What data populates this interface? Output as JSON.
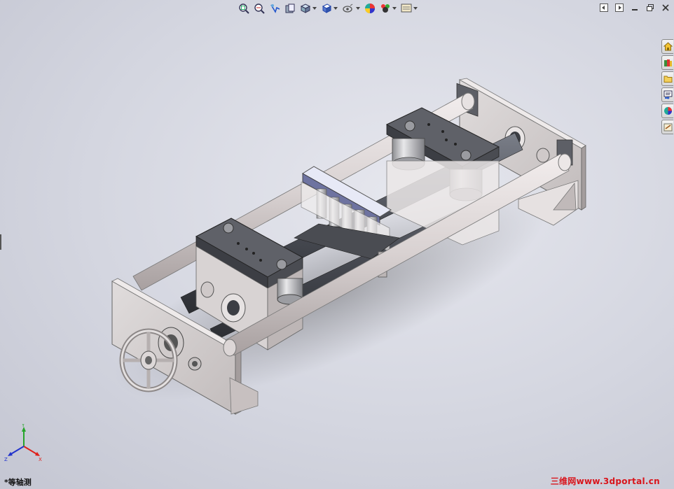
{
  "heads_up_toolbar": {
    "items": [
      {
        "name": "zoom-to-fit",
        "has_dropdown": false
      },
      {
        "name": "zoom-to-area",
        "has_dropdown": false
      },
      {
        "name": "previous-view",
        "has_dropdown": false
      },
      {
        "name": "section-view",
        "has_dropdown": false
      },
      {
        "name": "view-orientation",
        "has_dropdown": true
      },
      {
        "name": "display-style",
        "has_dropdown": true
      },
      {
        "name": "hide-show-items",
        "has_dropdown": true
      },
      {
        "name": "edit-appearance",
        "has_dropdown": false
      },
      {
        "name": "apply-scene",
        "has_dropdown": true
      },
      {
        "name": "view-settings",
        "has_dropdown": true
      }
    ]
  },
  "window_controls": {
    "buttons": [
      "tile-left",
      "tile-right",
      "minimize",
      "restore",
      "close"
    ]
  },
  "task_pane": {
    "tabs": [
      "solidworks-resources-icon",
      "design-library-icon",
      "file-explorer-icon",
      "view-palette-icon",
      "appearances-icon",
      "custom-properties-icon"
    ]
  },
  "triad": {
    "x_label": "X",
    "y_label": "Y",
    "z_label": "Z"
  },
  "view_label": "*等轴测",
  "watermark": "三维网www.3dportal.cn",
  "colors": {
    "background": "#d4d6e0",
    "frame_plate": "#d3cece",
    "rod": "#d8d2d2",
    "dark_shaft": "#4a4d55",
    "steel_block": "#6c6d74",
    "watermark": "#d9141b",
    "axis_x": "#e0201a",
    "axis_y": "#26a52a",
    "axis_z": "#2233cc"
  }
}
